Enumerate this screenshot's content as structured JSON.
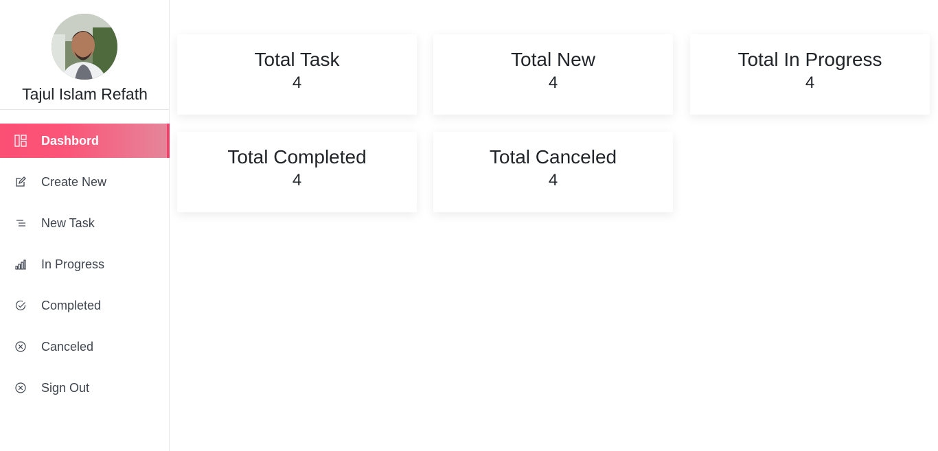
{
  "profile": {
    "name": "Tajul Islam Refath"
  },
  "sidebar": {
    "active_color": "#fb4f74",
    "items": [
      {
        "label": "Dashbord",
        "icon": "dashboard-grid-icon",
        "active": true
      },
      {
        "label": "Create New",
        "icon": "edit-icon",
        "active": false
      },
      {
        "label": "New Task",
        "icon": "list-icon",
        "active": false
      },
      {
        "label": "In Progress",
        "icon": "bar-chart-icon",
        "active": false
      },
      {
        "label": "Completed",
        "icon": "check-circle-icon",
        "active": false
      },
      {
        "label": "Canceled",
        "icon": "x-circle-icon",
        "active": false
      },
      {
        "label": "Sign Out",
        "icon": "x-circle-icon",
        "active": false
      }
    ]
  },
  "summary": {
    "cards": [
      {
        "title": "Total Task",
        "value": "4"
      },
      {
        "title": "Total New",
        "value": "4"
      },
      {
        "title": "Total In Progress",
        "value": "4"
      },
      {
        "title": "Total Completed",
        "value": "4"
      },
      {
        "title": "Total Canceled",
        "value": "4"
      }
    ]
  }
}
